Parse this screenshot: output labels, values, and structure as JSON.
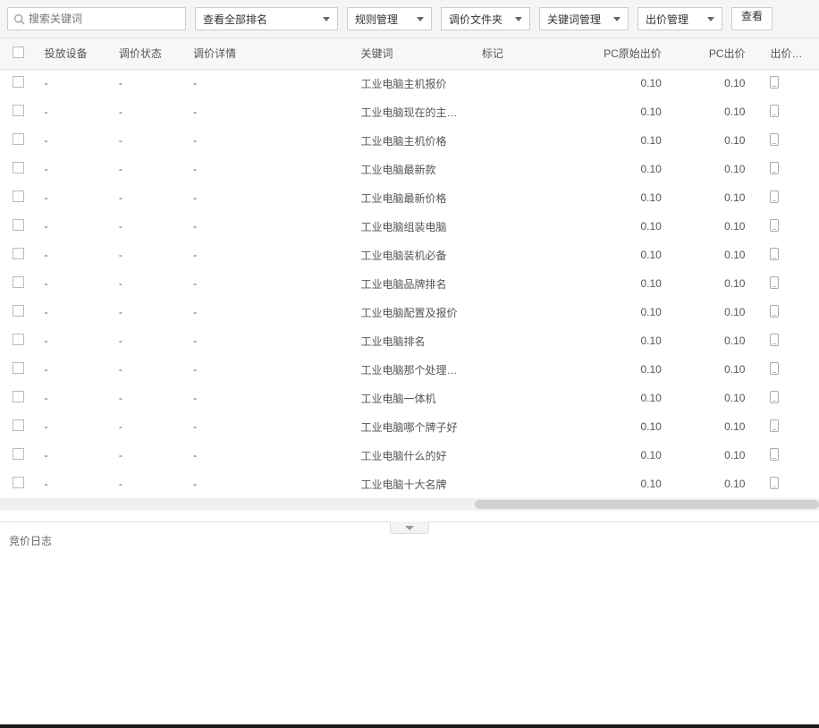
{
  "toolbar": {
    "search_placeholder": "搜索关键词",
    "ranking_dropdown": "查看全部排名",
    "rule_mgmt": "规则管理",
    "folder_mgmt": "调价文件夹",
    "keyword_mgmt": "关键词管理",
    "bid_mgmt": "出价管理",
    "view_btn": "查看"
  },
  "columns": {
    "device": "投放设备",
    "status": "调价状态",
    "detail": "调价详情",
    "keyword": "关键词",
    "tag": "标记",
    "pc_original": "PC原始出价",
    "pc_bid": "PC出价",
    "bid_ratio": "出价比例"
  },
  "rows": [
    {
      "device": "-",
      "status": "-",
      "detail": "-",
      "keyword": "工业电脑主机报价",
      "pc_original": "0.10",
      "pc_bid": "0.10"
    },
    {
      "device": "-",
      "status": "-",
      "detail": "-",
      "keyword": "工业电脑现在的主流配",
      "pc_original": "0.10",
      "pc_bid": "0.10"
    },
    {
      "device": "-",
      "status": "-",
      "detail": "-",
      "keyword": "工业电脑主机价格",
      "pc_original": "0.10",
      "pc_bid": "0.10"
    },
    {
      "device": "-",
      "status": "-",
      "detail": "-",
      "keyword": "工业电脑最新款",
      "pc_original": "0.10",
      "pc_bid": "0.10"
    },
    {
      "device": "-",
      "status": "-",
      "detail": "-",
      "keyword": "工业电脑最新价格",
      "pc_original": "0.10",
      "pc_bid": "0.10"
    },
    {
      "device": "-",
      "status": "-",
      "detail": "-",
      "keyword": "工业电脑组装电脑",
      "pc_original": "0.10",
      "pc_bid": "0.10"
    },
    {
      "device": "-",
      "status": "-",
      "detail": "-",
      "keyword": "工业电脑装机必备",
      "pc_original": "0.10",
      "pc_bid": "0.10"
    },
    {
      "device": "-",
      "status": "-",
      "detail": "-",
      "keyword": "工业电脑品牌排名",
      "pc_original": "0.10",
      "pc_bid": "0.10"
    },
    {
      "device": "-",
      "status": "-",
      "detail": "-",
      "keyword": "工业电脑配置及报价",
      "pc_original": "0.10",
      "pc_bid": "0.10"
    },
    {
      "device": "-",
      "status": "-",
      "detail": "-",
      "keyword": "工业电脑排名",
      "pc_original": "0.10",
      "pc_bid": "0.10"
    },
    {
      "device": "-",
      "status": "-",
      "detail": "-",
      "keyword": "工业电脑那个处理器好",
      "pc_original": "0.10",
      "pc_bid": "0.10"
    },
    {
      "device": "-",
      "status": "-",
      "detail": "-",
      "keyword": "工业电脑一体机",
      "pc_original": "0.10",
      "pc_bid": "0.10"
    },
    {
      "device": "-",
      "status": "-",
      "detail": "-",
      "keyword": "工业电脑哪个牌子好",
      "pc_original": "0.10",
      "pc_bid": "0.10"
    },
    {
      "device": "-",
      "status": "-",
      "detail": "-",
      "keyword": "工业电脑什么的好",
      "pc_original": "0.10",
      "pc_bid": "0.10"
    },
    {
      "device": "-",
      "status": "-",
      "detail": "-",
      "keyword": "工业电脑十大名牌",
      "pc_original": "0.10",
      "pc_bid": "0.10"
    }
  ],
  "bottom_panel": {
    "title": "竞价日志"
  }
}
